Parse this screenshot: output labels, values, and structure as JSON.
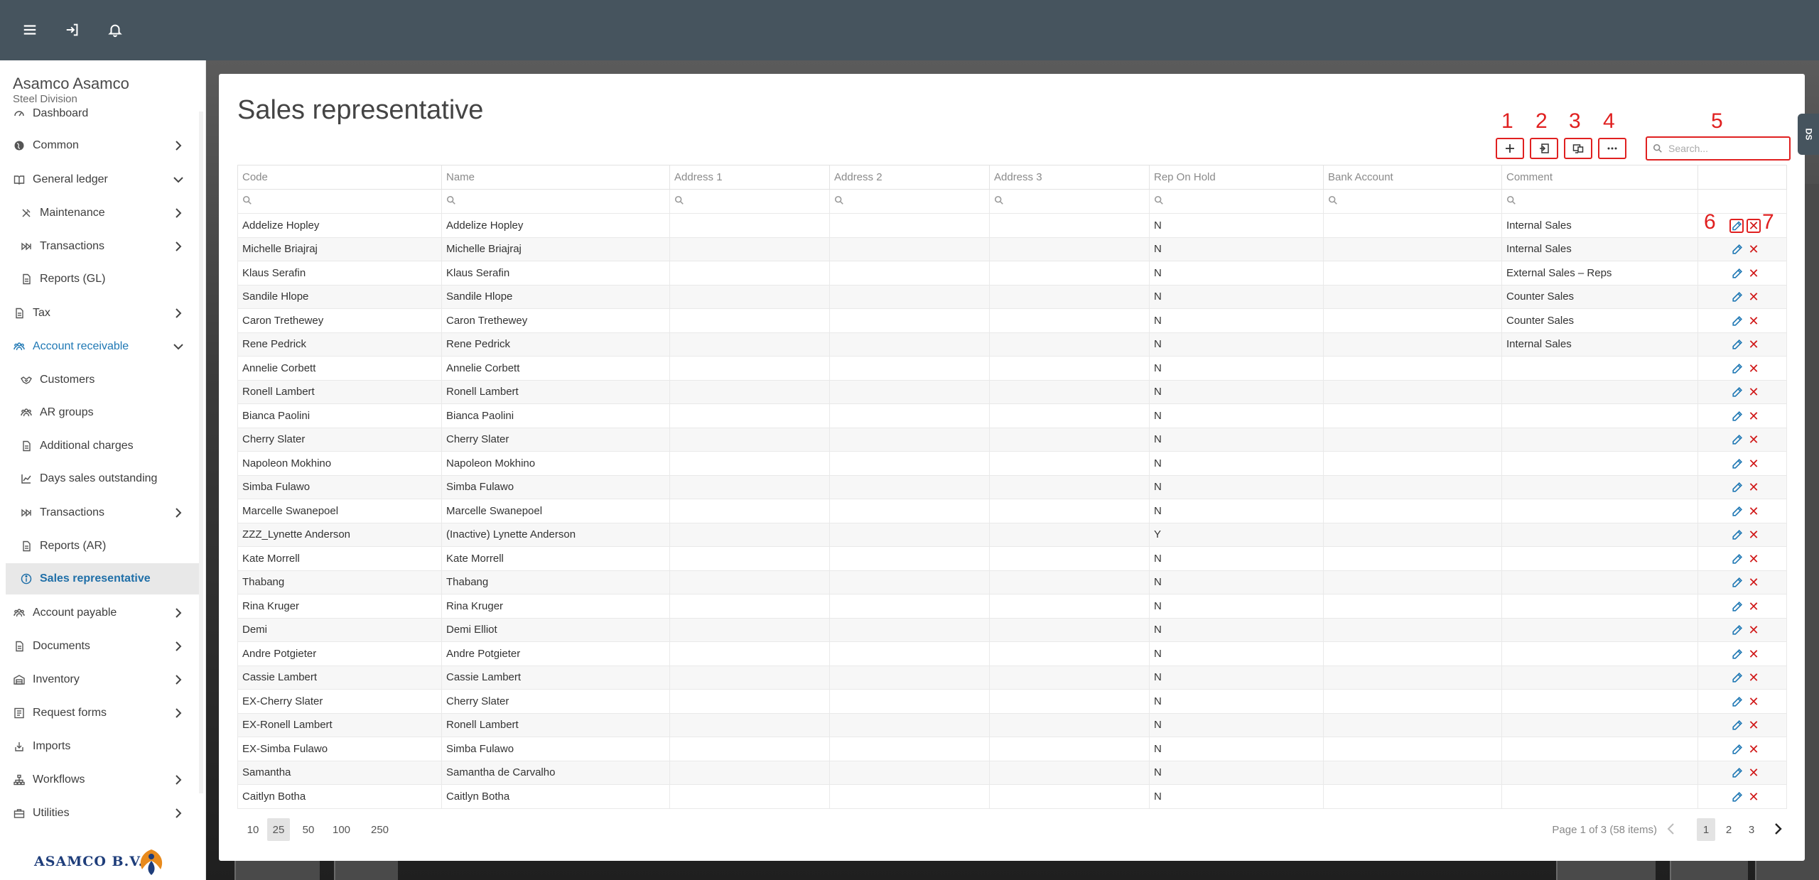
{
  "topbar": {
    "icons": [
      "menu-icon",
      "logout-icon",
      "bell-icon"
    ]
  },
  "sidebar": {
    "company": "Asamco Asamco",
    "division": "Steel Division",
    "items": [
      {
        "label": "Dashboard",
        "icon": "dashboard-icon",
        "chevron": ""
      },
      {
        "label": "Common",
        "icon": "globe-icon",
        "chevron": "right"
      },
      {
        "label": "General ledger",
        "icon": "book-icon",
        "chevron": "down"
      },
      {
        "label": "Maintenance",
        "icon": "tools-icon",
        "chevron": "right"
      },
      {
        "label": "Transactions",
        "icon": "fast-forward-icon",
        "chevron": "right"
      },
      {
        "label": "Reports (GL)",
        "icon": "document-icon",
        "chevron": ""
      },
      {
        "label": "Tax",
        "icon": "document-icon",
        "chevron": "right"
      },
      {
        "label": "Account receivable",
        "icon": "users-icon",
        "chevron": "down"
      },
      {
        "label": "Customers",
        "icon": "handshake-icon",
        "chevron": ""
      },
      {
        "label": "AR groups",
        "icon": "users-icon",
        "chevron": ""
      },
      {
        "label": "Additional charges",
        "icon": "document-icon",
        "chevron": ""
      },
      {
        "label": "Days sales outstanding",
        "icon": "chart-line-icon",
        "chevron": ""
      },
      {
        "label": "Transactions",
        "icon": "fast-forward-icon",
        "chevron": "right"
      },
      {
        "label": "Reports (AR)",
        "icon": "document-icon",
        "chevron": ""
      },
      {
        "label": "Sales representative",
        "icon": "info-icon",
        "chevron": ""
      },
      {
        "label": "Account payable",
        "icon": "users-icon",
        "chevron": "right"
      },
      {
        "label": "Documents",
        "icon": "document-icon",
        "chevron": "right"
      },
      {
        "label": "Inventory",
        "icon": "warehouse-icon",
        "chevron": "right"
      },
      {
        "label": "Request forms",
        "icon": "form-icon",
        "chevron": "right"
      },
      {
        "label": "Imports",
        "icon": "import-icon",
        "chevron": ""
      },
      {
        "label": "Workflows",
        "icon": "workflow-icon",
        "chevron": "right"
      },
      {
        "label": "Utilities",
        "icon": "briefcase-icon",
        "chevron": "right"
      }
    ],
    "logo_text": "ASAMCO B.V."
  },
  "page": {
    "title": "Sales representative",
    "search_placeholder": "Search...",
    "annotations": [
      "1",
      "2",
      "3",
      "4",
      "5",
      "6",
      "7"
    ]
  },
  "grid": {
    "columns": [
      "Code",
      "Name",
      "Address 1",
      "Address 2",
      "Address 3",
      "Rep On Hold",
      "Bank Account",
      "Comment"
    ],
    "rows": [
      [
        "Addelize Hopley",
        "Addelize Hopley",
        "",
        "",
        "",
        "N",
        "",
        "Internal Sales"
      ],
      [
        "Michelle Briajraj",
        "Michelle Briajraj",
        "",
        "",
        "",
        "N",
        "",
        "Internal Sales"
      ],
      [
        "Klaus Serafin",
        "Klaus Serafin",
        "",
        "",
        "",
        "N",
        "",
        "External Sales – Reps"
      ],
      [
        "Sandile Hlope",
        "Sandile Hlope",
        "",
        "",
        "",
        "N",
        "",
        "Counter Sales"
      ],
      [
        "Caron Trethewey",
        "Caron Trethewey",
        "",
        "",
        "",
        "N",
        "",
        "Counter Sales"
      ],
      [
        "Rene Pedrick",
        "Rene Pedrick",
        "",
        "",
        "",
        "N",
        "",
        "Internal Sales"
      ],
      [
        "Annelie Corbett",
        "Annelie Corbett",
        "",
        "",
        "",
        "N",
        "",
        ""
      ],
      [
        "Ronell Lambert",
        "Ronell Lambert",
        "",
        "",
        "",
        "N",
        "",
        ""
      ],
      [
        "Bianca Paolini",
        "Bianca Paolini",
        "",
        "",
        "",
        "N",
        "",
        ""
      ],
      [
        "Cherry Slater",
        "Cherry Slater",
        "",
        "",
        "",
        "N",
        "",
        ""
      ],
      [
        "Napoleon Mokhino",
        "Napoleon Mokhino",
        "",
        "",
        "",
        "N",
        "",
        ""
      ],
      [
        "Simba Fulawo",
        "Simba Fulawo",
        "",
        "",
        "",
        "N",
        "",
        ""
      ],
      [
        "Marcelle Swanepoel",
        "Marcelle Swanepoel",
        "",
        "",
        "",
        "N",
        "",
        ""
      ],
      [
        "ZZZ_Lynette Anderson",
        "(Inactive) Lynette Anderson",
        "",
        "",
        "",
        "Y",
        "",
        ""
      ],
      [
        "Kate Morrell",
        "Kate Morrell",
        "",
        "",
        "",
        "N",
        "",
        ""
      ],
      [
        "Thabang",
        "Thabang",
        "",
        "",
        "",
        "N",
        "",
        ""
      ],
      [
        "Rina Kruger",
        "Rina Kruger",
        "",
        "",
        "",
        "N",
        "",
        ""
      ],
      [
        "Demi",
        "Demi Elliot",
        "",
        "",
        "",
        "N",
        "",
        ""
      ],
      [
        "Andre Potgieter",
        "Andre Potgieter",
        "",
        "",
        "",
        "N",
        "",
        ""
      ],
      [
        "Cassie Lambert",
        "Cassie Lambert",
        "",
        "",
        "",
        "N",
        "",
        ""
      ],
      [
        "EX-Cherry Slater",
        "Cherry Slater",
        "",
        "",
        "",
        "N",
        "",
        ""
      ],
      [
        "EX-Ronell Lambert",
        "Ronell Lambert",
        "",
        "",
        "",
        "N",
        "",
        ""
      ],
      [
        "EX-Simba Fulawo",
        "Simba Fulawo",
        "",
        "",
        "",
        "N",
        "",
        ""
      ],
      [
        "Samantha",
        "Samantha de Carvalho",
        "",
        "",
        "",
        "N",
        "",
        ""
      ],
      [
        "Caitlyn Botha",
        "Caitlyn Botha",
        "",
        "",
        "",
        "N",
        "",
        ""
      ]
    ]
  },
  "pager": {
    "sizes": [
      "10",
      "25",
      "50",
      "100",
      "250"
    ],
    "selected_size": "25",
    "info": "Page 1 of 3 (58 items)",
    "pages": [
      "1",
      "2",
      "3"
    ],
    "current_page": "1"
  },
  "ds_tab": {
    "label": "DS"
  },
  "colors": {
    "topbar": "#46545e",
    "accent": "#1f78b4",
    "annotation": "#e02020",
    "delete": "#d01818"
  }
}
